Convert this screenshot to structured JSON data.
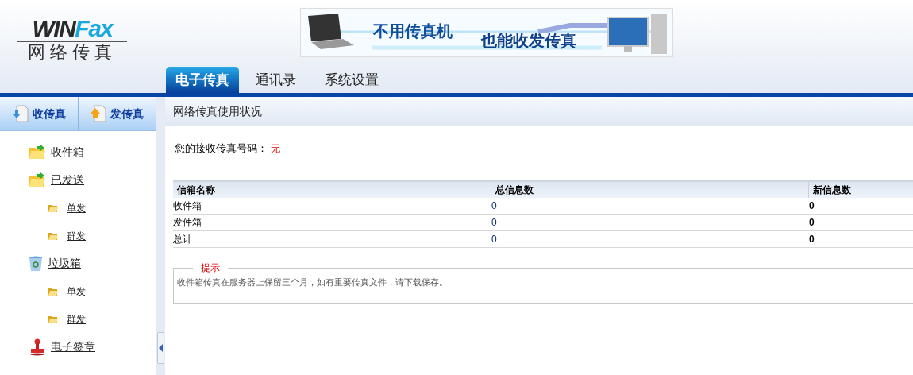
{
  "logo": {
    "brand": "WINFax",
    "subtitle": "网络传真"
  },
  "banner": {
    "slogan_1": "不用传真机",
    "slogan_2": "也能收发传真"
  },
  "tabs": [
    {
      "label": "电子传真",
      "selected": true
    },
    {
      "label": "通讯录",
      "selected": false
    },
    {
      "label": "系统设置",
      "selected": false
    }
  ],
  "sidebar": {
    "actions": [
      {
        "label": "收传真",
        "kind": "receive"
      },
      {
        "label": "发传真",
        "kind": "send"
      }
    ],
    "items": [
      {
        "label": "收件箱",
        "kind": "inbox"
      },
      {
        "label": "已发送",
        "kind": "sent",
        "children": [
          {
            "label": "单发",
            "kind": "folder"
          },
          {
            "label": "群发",
            "kind": "folder"
          }
        ]
      },
      {
        "label": "垃圾箱",
        "kind": "trash",
        "children": [
          {
            "label": "单发",
            "kind": "folder"
          },
          {
            "label": "群发",
            "kind": "folder"
          }
        ]
      },
      {
        "label": "电子签章",
        "kind": "stamp"
      }
    ]
  },
  "panel": {
    "title": "网络传真使用状况",
    "fax_number_label": "您的接收传真号码：",
    "fax_number": "无"
  },
  "table": {
    "columns": [
      "信箱名称",
      "总信息数",
      "新信息数"
    ],
    "rows": [
      [
        "收件箱",
        "0",
        "0"
      ],
      [
        "发件箱",
        "0",
        "0"
      ],
      [
        "总计",
        "0",
        "0"
      ]
    ]
  },
  "notice": {
    "legend": "提示",
    "text": "收件箱传真在服务器上保留三个月，如有重要传真文件，请下载保存。"
  }
}
